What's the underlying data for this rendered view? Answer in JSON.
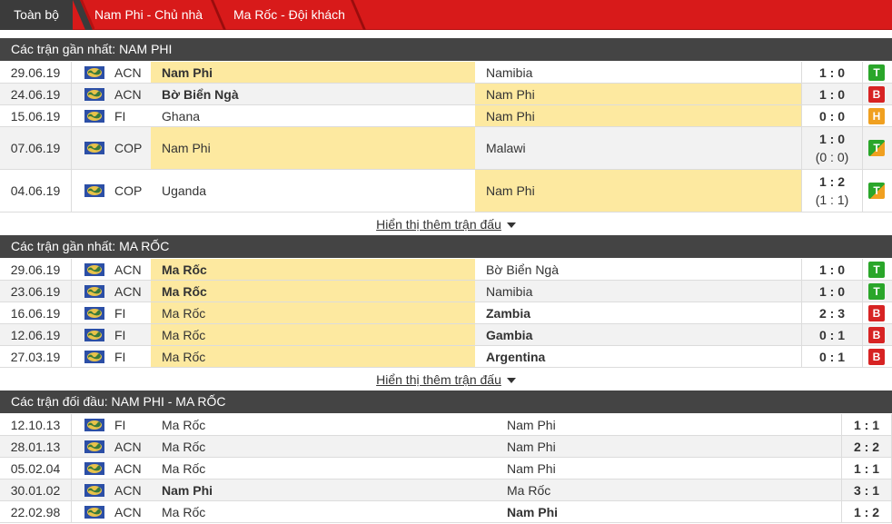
{
  "tabs": [
    {
      "label": "Toàn bộ",
      "active": true
    },
    {
      "label": "Nam Phi - Chủ nhà",
      "active": false
    },
    {
      "label": "Ma Rốc - Đội khách",
      "active": false
    }
  ],
  "colors": {
    "tab_bar": "#d81a1a",
    "header": "#444444",
    "highlight": "#fde9a0",
    "win": "#2aa62a",
    "loss": "#d72323",
    "draw": "#f0a020"
  },
  "sections": {
    "s1": {
      "title": "Các trận gần nhất: NAM PHI",
      "rows": [
        {
          "date": "29.06.19",
          "comp": "ACN",
          "home": "Nam Phi",
          "away": "Namibia",
          "score": "1 : 0",
          "result": "T"
        },
        {
          "date": "24.06.19",
          "comp": "ACN",
          "home": "Bờ Biển Ngà",
          "away": "Nam Phi",
          "score": "1 : 0",
          "result": "B"
        },
        {
          "date": "15.06.19",
          "comp": "FI",
          "home": "Ghana",
          "away": "Nam Phi",
          "score": "0 : 0",
          "result": "H"
        },
        {
          "date": "07.06.19",
          "comp": "COP",
          "home": "Nam Phi",
          "away": "Malawi",
          "score": "1 : 0",
          "ht": "(0 : 0)",
          "result": "T"
        },
        {
          "date": "04.06.19",
          "comp": "COP",
          "home": "Uganda",
          "away": "Nam Phi",
          "score": "1 : 2",
          "ht": "(1 : 1)",
          "result": "T"
        }
      ],
      "more": "Hiển thị thêm trận đấu"
    },
    "s2": {
      "title": "Các trận gần nhất: MA RỐC",
      "rows": [
        {
          "date": "29.06.19",
          "comp": "ACN",
          "home": "Ma Rốc",
          "away": "Bờ Biển Ngà",
          "score": "1 : 0",
          "result": "T"
        },
        {
          "date": "23.06.19",
          "comp": "ACN",
          "home": "Ma Rốc",
          "away": "Namibia",
          "score": "1 : 0",
          "result": "T"
        },
        {
          "date": "16.06.19",
          "comp": "FI",
          "home": "Ma Rốc",
          "away": "Zambia",
          "score": "2 : 3",
          "result": "B"
        },
        {
          "date": "12.06.19",
          "comp": "FI",
          "home": "Ma Rốc",
          "away": "Gambia",
          "score": "0 : 1",
          "result": "B"
        },
        {
          "date": "27.03.19",
          "comp": "FI",
          "home": "Ma Rốc",
          "away": "Argentina",
          "score": "0 : 1",
          "result": "B"
        }
      ],
      "more": "Hiển thị thêm trận đấu"
    },
    "s3": {
      "title": "Các trận đối đầu: NAM PHI - MA RỐC",
      "rows": [
        {
          "date": "12.10.13",
          "comp": "FI",
          "home": "Ma Rốc",
          "away": "Nam Phi",
          "score": "1 : 1"
        },
        {
          "date": "28.01.13",
          "comp": "ACN",
          "home": "Ma Rốc",
          "away": "Nam Phi",
          "score": "2 : 2"
        },
        {
          "date": "05.02.04",
          "comp": "ACN",
          "home": "Ma Rốc",
          "away": "Nam Phi",
          "score": "1 : 1"
        },
        {
          "date": "30.01.02",
          "comp": "ACN",
          "home": "Nam Phi",
          "away": "Ma Rốc",
          "score": "3 : 1"
        },
        {
          "date": "22.02.98",
          "comp": "ACN",
          "home": "Ma Rốc",
          "away": "Nam Phi",
          "score": "1 : 2"
        }
      ]
    }
  }
}
